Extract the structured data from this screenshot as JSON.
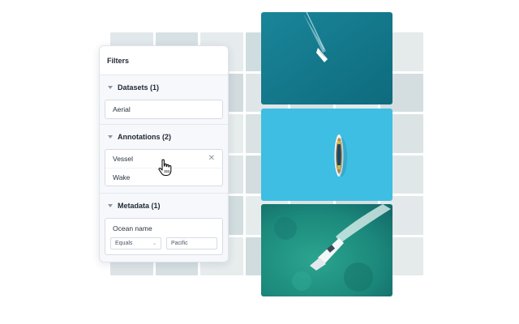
{
  "filters": {
    "title": "Filters",
    "datasets": {
      "label": "Datasets (1)",
      "value": "Aerial"
    },
    "annotations": {
      "label": "Annotations (2)",
      "items": [
        "Vessel",
        "Wake"
      ]
    },
    "metadata": {
      "label": "Metadata (1)",
      "field": "Ocean name",
      "operator": "Equals",
      "value": "Pacific"
    }
  },
  "images": [
    {
      "icon": "boat-deep-water-image",
      "water": "#177f92"
    },
    {
      "icon": "boat-turquoise-water-image",
      "water": "#3ebee2"
    },
    {
      "icon": "boat-shallow-water-image",
      "water": "#1e8f7e"
    }
  ],
  "icons": {
    "close": "close-icon",
    "caret": "caret-down-icon",
    "cursor": "hand-pointer-icon"
  }
}
